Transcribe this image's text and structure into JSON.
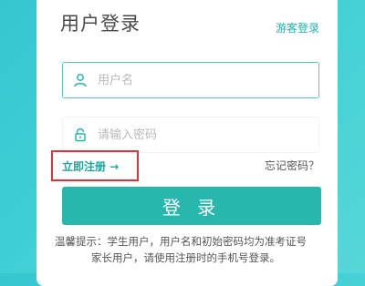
{
  "login": {
    "title": "用户登录",
    "guest_link": "游客登录",
    "username_placeholder": "用户名",
    "password_placeholder": "请输入密码",
    "register_link": "立即注册 →",
    "forgot_link": "忘记密码？",
    "login_button": "登 录",
    "tip_line1": "温馨提示：学生用户，用户名和初始密码均为准考证号",
    "tip_line2": "家长用户，请使用注册时的手机号登录。"
  },
  "icons": {
    "username": "user-icon",
    "password": "lock-icon"
  },
  "colors": {
    "accent": "#27b7ac",
    "link": "#1aa59f",
    "highlight_box": "#d9343b",
    "background": "#3ecfd6"
  }
}
